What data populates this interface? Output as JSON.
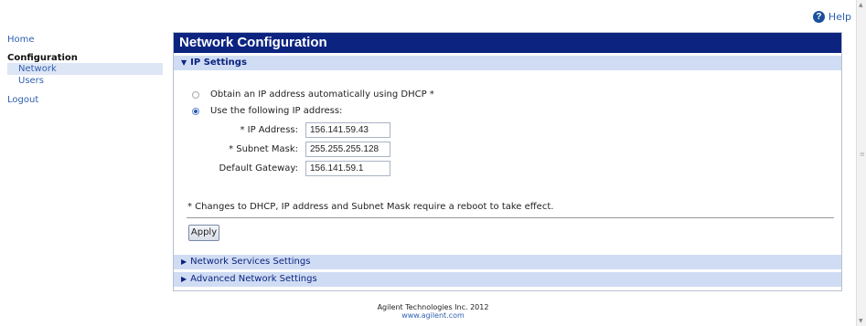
{
  "help": {
    "label": "Help",
    "icon": "help-circle-icon"
  },
  "sidebar": {
    "home": "Home",
    "section": "Configuration",
    "items": [
      {
        "label": "Network",
        "active": true
      },
      {
        "label": "Users",
        "active": false
      }
    ],
    "logout": "Logout"
  },
  "panel": {
    "title": "Network Configuration",
    "ip_section": "IP Settings",
    "dhcp_option": "Obtain an IP address automatically using DHCP *",
    "static_option": "Use the following IP address:",
    "selected_option": "static",
    "fields": {
      "ip": {
        "label": "* IP Address:",
        "value": "156.141.59.43"
      },
      "subnet": {
        "label": "* Subnet Mask:",
        "value": "255.255.255.128"
      },
      "gateway": {
        "label": "Default Gateway:",
        "value": "156.141.59.1"
      }
    },
    "note": "* Changes to DHCP, IP address and Subnet Mask require a reboot to take effect.",
    "apply_label": "Apply",
    "network_services": "Network Services Settings",
    "advanced": "Advanced Network Settings"
  },
  "footer": {
    "company": "Agilent Technologies Inc. 2012",
    "link": "www.agilent.com"
  },
  "colors": {
    "title_bar": "#0c2480",
    "section_bar": "#cfdcf3",
    "link": "#3060b0"
  }
}
